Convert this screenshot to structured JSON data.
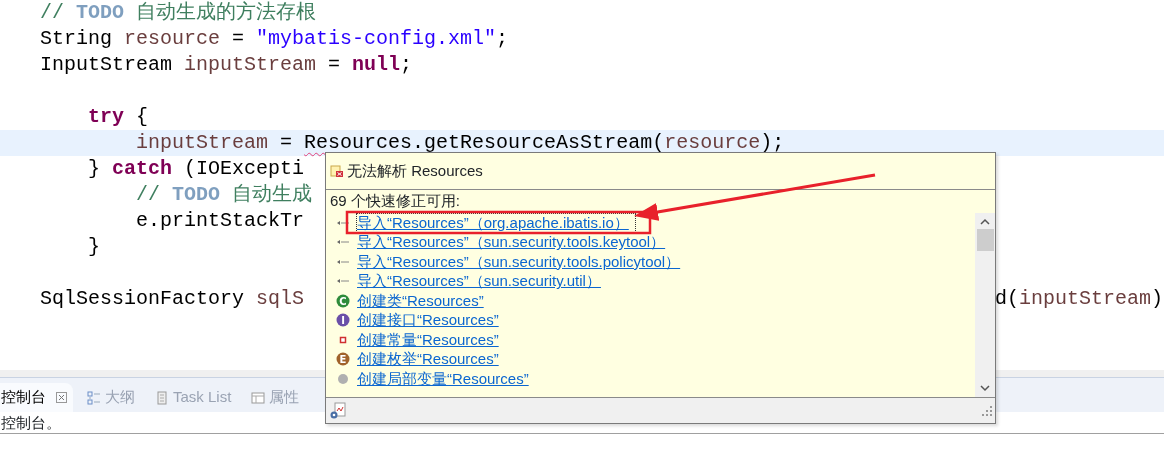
{
  "editor": {
    "lines": [
      {
        "kind": "code",
        "current": false,
        "tokens": [
          {
            "kind": "comment",
            "text": "// "
          },
          {
            "kind": "todo",
            "text": "TODO"
          },
          {
            "kind": "comment",
            "text": " 自动生成的方法存根"
          }
        ]
      },
      {
        "kind": "code",
        "current": false,
        "tokens": [
          {
            "kind": "plain",
            "text": "String "
          },
          {
            "kind": "var",
            "text": "resource"
          },
          {
            "kind": "plain",
            "text": " = "
          },
          {
            "kind": "string",
            "text": "\"mybatis-config.xml\""
          },
          {
            "kind": "plain",
            "text": ";"
          }
        ]
      },
      {
        "kind": "code",
        "current": false,
        "tokens": [
          {
            "kind": "plain",
            "text": "InputStream "
          },
          {
            "kind": "var",
            "text": "inputStream"
          },
          {
            "kind": "plain",
            "text": " = "
          },
          {
            "kind": "keyword",
            "text": "null"
          },
          {
            "kind": "plain",
            "text": ";"
          }
        ]
      },
      {
        "kind": "blank"
      },
      {
        "kind": "code",
        "current": false,
        "tokens": [
          {
            "kind": "keyword",
            "text": "    try"
          },
          {
            "kind": "plain",
            "text": " {"
          }
        ]
      },
      {
        "kind": "code",
        "current": true,
        "tokens": [
          {
            "kind": "var",
            "text": "        inputStream"
          },
          {
            "kind": "plain",
            "text": " = "
          },
          {
            "kind": "plain",
            "text": "Resources",
            "error": true
          },
          {
            "kind": "plain",
            "text": ".getResourceAsStream("
          },
          {
            "kind": "var",
            "text": "resource"
          },
          {
            "kind": "plain",
            "text": ");"
          }
        ]
      },
      {
        "kind": "code",
        "current": false,
        "tokens": [
          {
            "kind": "plain",
            "text": "    } "
          },
          {
            "kind": "keyword",
            "text": "catch"
          },
          {
            "kind": "plain",
            "text": " (IOExcepti"
          }
        ]
      },
      {
        "kind": "code",
        "current": false,
        "tokens": [
          {
            "kind": "comment",
            "text": "        // "
          },
          {
            "kind": "todo",
            "text": "TODO"
          },
          {
            "kind": "comment",
            "text": " 自动生成"
          }
        ]
      },
      {
        "kind": "code",
        "current": false,
        "tokens": [
          {
            "kind": "plain",
            "text": "        e.printStackTr"
          }
        ]
      },
      {
        "kind": "code",
        "current": false,
        "tokens": [
          {
            "kind": "plain",
            "text": "    }"
          }
        ]
      },
      {
        "kind": "blank"
      },
      {
        "kind": "code",
        "current": false,
        "tokens": [
          {
            "kind": "plain",
            "text": "SqlSessionFactory "
          },
          {
            "kind": "var",
            "text": "sqlS"
          }
        ],
        "right_tokens": [
          {
            "kind": "plain",
            "text": "d("
          },
          {
            "kind": "var",
            "text": "inputStream"
          },
          {
            "kind": "plain",
            "text": ")"
          }
        ]
      }
    ]
  },
  "quick_fix": {
    "title": "无法解析 Resources",
    "count_label": "69 个快速修正可用:",
    "items": [
      {
        "kind": "import",
        "label": "导入“Resources”（org.apache.ibatis.io）",
        "selected": true
      },
      {
        "kind": "import",
        "label": "导入“Resources”（sun.security.tools.keytool）",
        "selected": false
      },
      {
        "kind": "import",
        "label": "导入“Resources”（sun.security.tools.policytool）",
        "selected": false
      },
      {
        "kind": "import",
        "label": "导入“Resources”（sun.security.util）",
        "selected": false
      },
      {
        "kind": "class",
        "badge": "C",
        "label": "创建类“Resources”",
        "selected": false
      },
      {
        "kind": "interface",
        "badge": "I",
        "label": "创建接口“Resources”",
        "selected": false
      },
      {
        "kind": "constant",
        "label": "创建常量“Resources”",
        "selected": false
      },
      {
        "kind": "enum",
        "badge": "E",
        "label": "创建枚举“Resources”",
        "selected": false
      },
      {
        "kind": "local",
        "label": "创建局部变量“Resources”",
        "selected": false
      }
    ]
  },
  "bottom_panel": {
    "tabs": [
      {
        "kind": "console",
        "label": "控制台",
        "selected": true
      },
      {
        "kind": "outline",
        "label": "大纲",
        "selected": false
      },
      {
        "kind": "tasks",
        "label": "Task List",
        "selected": false
      },
      {
        "kind": "properties",
        "label": "属性",
        "selected": false
      }
    ],
    "message": "控制台。"
  }
}
